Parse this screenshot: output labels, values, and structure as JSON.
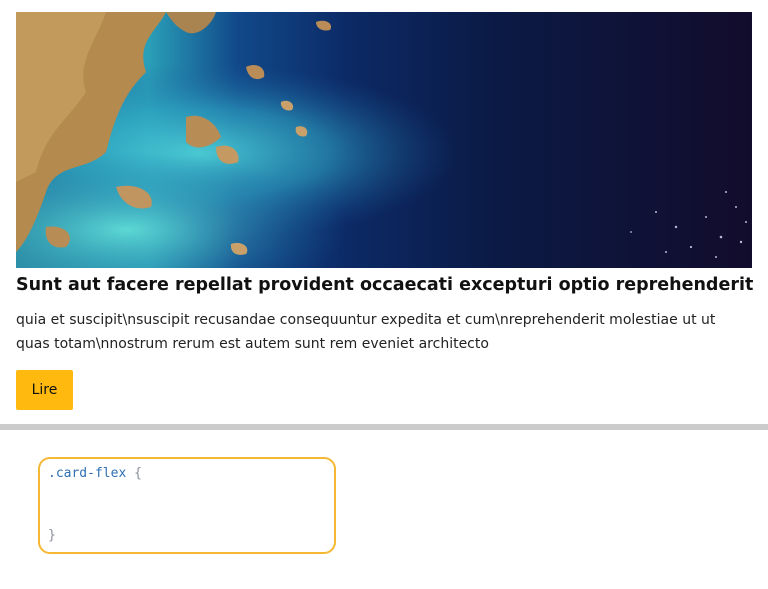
{
  "card": {
    "image_alt": "Satellite view of coastline with turquoise shallow water",
    "title": "Sunt aut facere repellat provident occaecati excepturi optio reprehenderit",
    "body": "quia et suscipit\\nsuscipit recusandae consequuntur expedita et cum\\nreprehenderit molestiae ut ut quas totam\\nnostrum rerum est autem sunt rem eveniet architecto",
    "button_label": "Lire"
  },
  "code_editor": {
    "selector": ".card-flex",
    "open_brace": "{",
    "close_brace": "}"
  },
  "colors": {
    "button": "#ffb90f",
    "editor_border": "#f5b833",
    "divider": "#cccccc"
  }
}
